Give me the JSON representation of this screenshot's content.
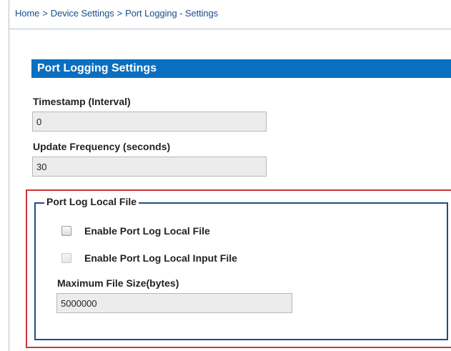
{
  "breadcrumb": {
    "items": [
      "Home",
      "Device Settings",
      "Port Logging - Settings"
    ],
    "separator": ">"
  },
  "section": {
    "title": "Port Logging Settings"
  },
  "fields": {
    "timestamp": {
      "label": "Timestamp (Interval)",
      "value": "0"
    },
    "update_frequency": {
      "label": "Update Frequency (seconds)",
      "value": "30"
    }
  },
  "local_file": {
    "legend": "Port Log Local File",
    "enable_local_file": {
      "label": "Enable Port Log Local File",
      "checked": false,
      "enabled": true
    },
    "enable_local_input_file": {
      "label": "Enable Port Log Local Input File",
      "checked": false,
      "enabled": false
    },
    "max_file_size": {
      "label": "Maximum File Size(bytes)",
      "value": "5000000"
    }
  },
  "colors": {
    "header_blue": "#0b6fc0",
    "link_blue": "#1a4e8c",
    "fieldset_border": "#1e4f86",
    "highlight_red": "#d0343b",
    "input_bg": "#ececec"
  }
}
